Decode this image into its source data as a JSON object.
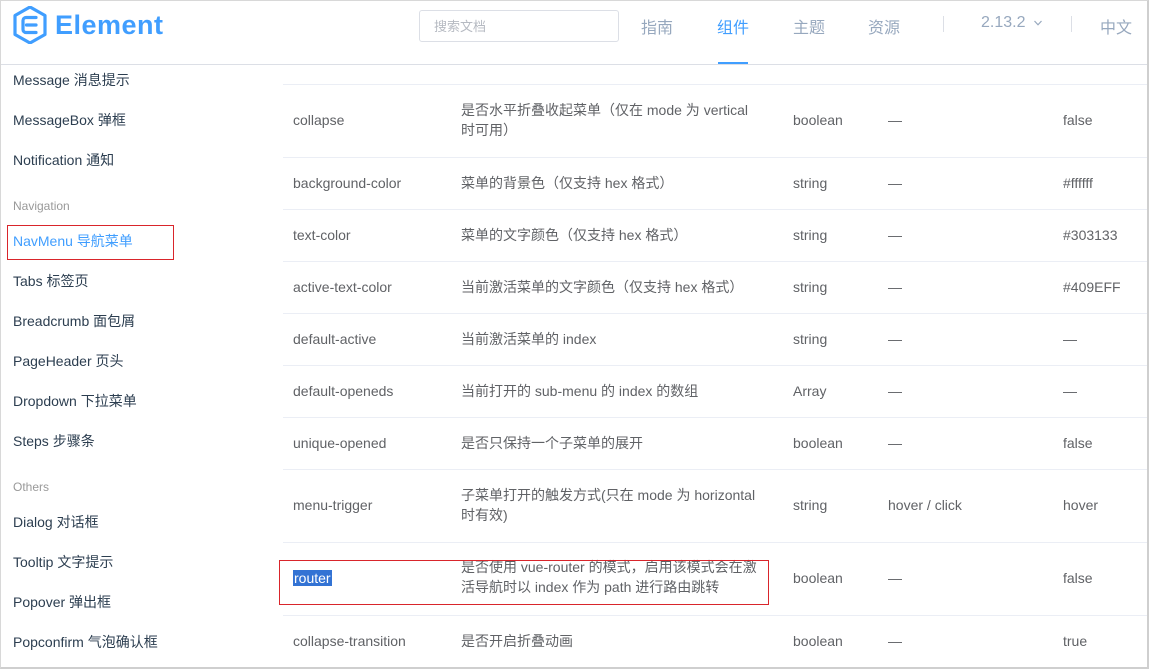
{
  "header": {
    "logo_text": "Element",
    "search_placeholder": "搜索文档",
    "nav": [
      "指南",
      "组件",
      "主题",
      "资源"
    ],
    "active_nav": "组件",
    "version": "2.13.2",
    "lang": "中文",
    "brand_color": "#409EFF"
  },
  "sidebar": {
    "items_top": [
      "Message 消息提示",
      "MessageBox 弹框",
      "Notification 通知"
    ],
    "group_navigation": "Navigation",
    "items_nav": [
      "NavMenu 导航菜单",
      "Tabs 标签页",
      "Breadcrumb 面包屑",
      "PageHeader 页头",
      "Dropdown 下拉菜单",
      "Steps 步骤条"
    ],
    "group_others": "Others",
    "items_others": [
      "Dialog 对话框",
      "Tooltip 文字提示",
      "Popover 弹出框",
      "Popconfirm 气泡确认框"
    ],
    "active_item": "NavMenu 导航菜单"
  },
  "table": {
    "rows": [
      {
        "name": "collapse",
        "desc": "是否水平折叠收起菜单（仅在 mode 为 vertical 时可用）",
        "type": "boolean",
        "options": "—",
        "default": "false"
      },
      {
        "name": "background-color",
        "desc": "菜单的背景色（仅支持 hex 格式）",
        "type": "string",
        "options": "—",
        "default": "#ffffff"
      },
      {
        "name": "text-color",
        "desc": "菜单的文字颜色（仅支持 hex 格式）",
        "type": "string",
        "options": "—",
        "default": "#303133"
      },
      {
        "name": "active-text-color",
        "desc": "当前激活菜单的文字颜色（仅支持 hex 格式）",
        "type": "string",
        "options": "—",
        "default": "#409EFF"
      },
      {
        "name": "default-active",
        "desc": "当前激活菜单的 index",
        "type": "string",
        "options": "—",
        "default": "—"
      },
      {
        "name": "default-openeds",
        "desc": "当前打开的 sub-menu 的 index 的数组",
        "type": "Array",
        "options": "—",
        "default": "—"
      },
      {
        "name": "unique-opened",
        "desc": "是否只保持一个子菜单的展开",
        "type": "boolean",
        "options": "—",
        "default": "false"
      },
      {
        "name": "menu-trigger",
        "desc": "子菜单打开的触发方式(只在 mode 为 horizontal 时有效)",
        "type": "string",
        "options": "hover / click",
        "default": "hover"
      },
      {
        "name": "router",
        "desc": "是否使用 vue-router 的模式，启用该模式会在激活导航时以 index 作为 path 进行路由跳转",
        "type": "boolean",
        "options": "—",
        "default": "false"
      },
      {
        "name": "collapse-transition",
        "desc": "是否开启折叠动画",
        "type": "boolean",
        "options": "—",
        "default": "true"
      }
    ]
  }
}
